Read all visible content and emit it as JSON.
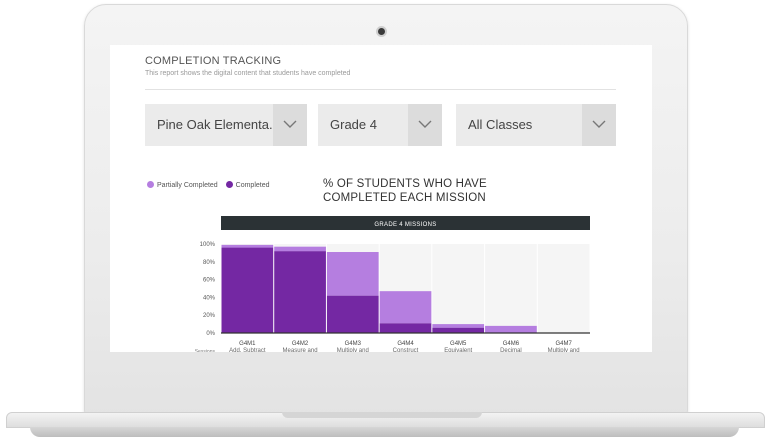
{
  "report": {
    "title": "COMPLETION TRACKING",
    "subtitle": "This report shows the digital content that students have completed"
  },
  "filters": {
    "school": "Pine Oak Elementa...",
    "grade": "Grade 4",
    "classes": "All Classes"
  },
  "legend": {
    "partial_label": "Partially Completed",
    "completed_label": "Completed",
    "partial_color": "#b57ee0",
    "completed_color": "#7428a3"
  },
  "chart_heading_line1": "% OF STUDENTS WHO HAVE",
  "chart_heading_line2": "COMPLETED EACH MISSION",
  "chart_data": {
    "type": "bar",
    "stacked": true,
    "header": "GRADE 4 MISSIONS",
    "categories": [
      "G4M1",
      "G4M2",
      "G4M3",
      "G4M4",
      "G4M5",
      "G4M6",
      "G4M7"
    ],
    "category_sublabels": [
      "Add, Subtract",
      "Measure and",
      "Multiply and",
      "Construct",
      "Equivalent",
      "Decimal",
      "Multiply and"
    ],
    "yticks": [
      "100%",
      "80%",
      "60%",
      "40%",
      "20%",
      "0%"
    ],
    "ylim": [
      0,
      100
    ],
    "series": [
      {
        "name": "Completed",
        "values": [
          96,
          92,
          42,
          11,
          6,
          0,
          0
        ]
      },
      {
        "name": "Partially Completed",
        "values": [
          3,
          5,
          49,
          36,
          4,
          8,
          0
        ]
      }
    ],
    "row_label_partial": "Sessions"
  }
}
